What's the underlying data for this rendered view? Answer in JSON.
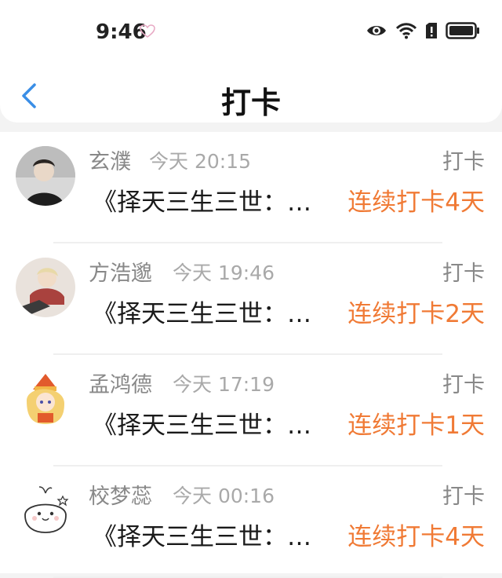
{
  "status": {
    "time": "9:46"
  },
  "nav": {
    "title": "打卡"
  },
  "items": [
    {
      "name": "玄濮",
      "time": "今天 20:15",
      "action": "打卡",
      "text": "《择天三生三世：…",
      "streak": "连续打卡4天"
    },
    {
      "name": "方浩邈",
      "time": "今天 19:46",
      "action": "打卡",
      "text": "《择天三生三世：…",
      "streak": "连续打卡2天"
    },
    {
      "name": "孟鸿德",
      "time": "今天 17:19",
      "action": "打卡",
      "text": "《择天三生三世：…",
      "streak": "连续打卡1天"
    },
    {
      "name": "校梦蕊",
      "time": "今天 00:16",
      "action": "打卡",
      "text": "《择天三生三世：…",
      "streak": "连续打卡4天"
    }
  ],
  "colors": {
    "accent": "#f07a35",
    "back": "#3a8ee6"
  }
}
